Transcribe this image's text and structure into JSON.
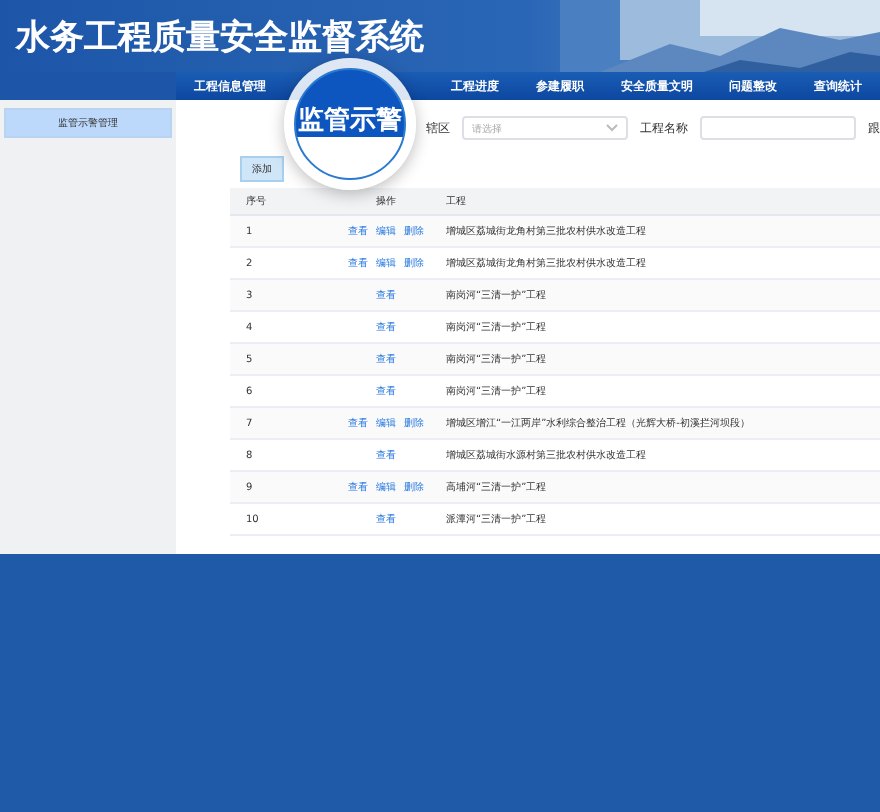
{
  "header": {
    "title": "水务工程质量安全监督系统"
  },
  "nav": [
    {
      "label": "工程信息管理",
      "selected": false
    },
    {
      "label": "工程进度",
      "selected": false
    },
    {
      "label": "参建履职",
      "selected": false
    },
    {
      "label": "安全质量文明",
      "selected": false
    },
    {
      "label": "问题整改",
      "selected": false
    },
    {
      "label": "查询统计",
      "selected": false
    }
  ],
  "magnifier": {
    "label": "监管示警"
  },
  "sidebar": {
    "items": [
      {
        "label": "监管示警管理",
        "selected": true
      }
    ]
  },
  "filters": [
    {
      "label": "辖区",
      "placeholder": "请选择",
      "kind": "select"
    },
    {
      "label": "工程名称",
      "kind": "input"
    },
    {
      "label": "跟",
      "kind": "label"
    }
  ],
  "add_button": "添加",
  "table": {
    "columns": [
      "序号",
      "操作",
      "工程"
    ],
    "rows": [
      {
        "index": "1",
        "actions": [
          "查看",
          "编辑",
          "删除"
        ],
        "project": "增城区荔城街龙角村第三批农村供水改造工程"
      },
      {
        "index": "2",
        "actions": [
          "查看",
          "编辑",
          "删除"
        ],
        "project": "增城区荔城街龙角村第三批农村供水改造工程"
      },
      {
        "index": "3",
        "actions": [
          "查看"
        ],
        "project": "南岗河“三清一护”工程"
      },
      {
        "index": "4",
        "actions": [
          "查看"
        ],
        "project": "南岗河“三清一护”工程"
      },
      {
        "index": "5",
        "actions": [
          "查看"
        ],
        "project": "南岗河“三清一护”工程"
      },
      {
        "index": "6",
        "actions": [
          "查看"
        ],
        "project": "南岗河“三清一护”工程"
      },
      {
        "index": "7",
        "actions": [
          "查看",
          "编辑",
          "删除"
        ],
        "project": "增城区增江“一江两岸”水利综合整治工程（光辉大桥-初溪拦河坝段）"
      },
      {
        "index": "8",
        "actions": [
          "查看"
        ],
        "project": "增城区荔城街水源村第三批农村供水改造工程"
      },
      {
        "index": "9",
        "actions": [
          "查看",
          "编辑",
          "删除"
        ],
        "project": "高埔河“三清一护”工程"
      },
      {
        "index": "10",
        "actions": [
          "查看"
        ],
        "project": "派潭河“三清一护”工程"
      }
    ]
  }
}
